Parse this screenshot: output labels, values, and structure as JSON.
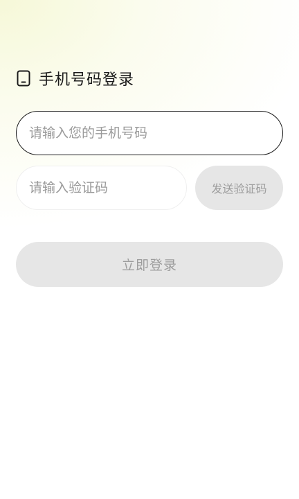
{
  "header": {
    "icon": "phone-icon",
    "title": "手机号码登录"
  },
  "form": {
    "phone_placeholder": "请输入您的手机号码",
    "phone_value": "",
    "code_placeholder": "请输入验证码",
    "code_value": "",
    "send_code_label": "发送验证码",
    "login_label": "立即登录"
  },
  "colors": {
    "button_disabled_bg": "#e6e6e6",
    "button_disabled_text": "#9c9c9c",
    "active_border": "#1b1b1b"
  }
}
